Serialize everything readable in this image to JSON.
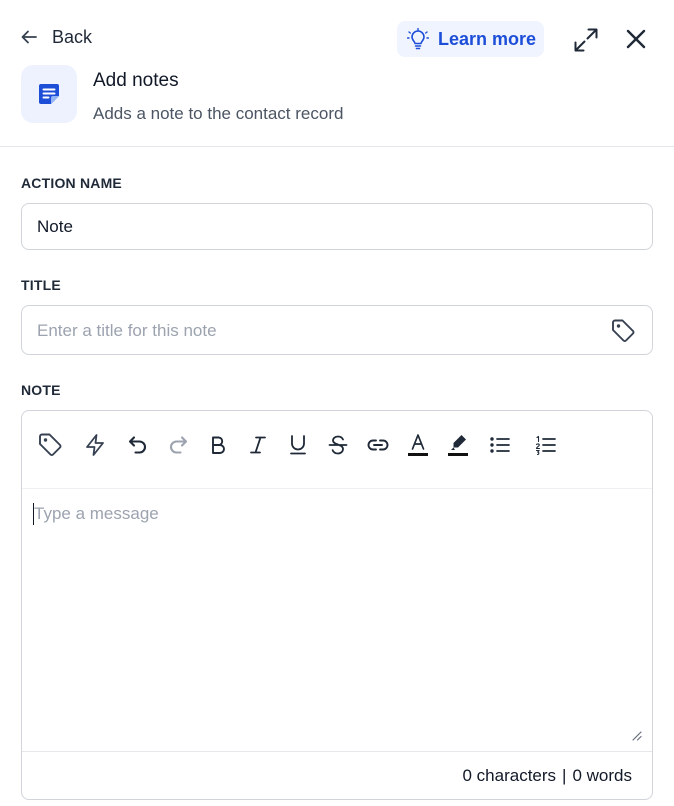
{
  "header": {
    "back_label": "Back",
    "learn_more_label": "Learn more",
    "action_title": "Add notes",
    "action_subtitle": "Adds a note to the contact record"
  },
  "form": {
    "action_name": {
      "label": "ACTION NAME",
      "value": "Note"
    },
    "title": {
      "label": "TITLE",
      "placeholder": "Enter a title for this note",
      "value": ""
    },
    "note": {
      "label": "NOTE",
      "placeholder": "Type a message",
      "value": ""
    }
  },
  "toolbar": {
    "items": [
      "tag-icon",
      "lightning-icon",
      "undo-icon",
      "redo-icon",
      "bold-icon",
      "italic-icon",
      "underline-icon",
      "strikethrough-icon",
      "link-icon",
      "text-color-icon",
      "highlight-icon",
      "bullet-list-icon",
      "numbered-list-icon"
    ]
  },
  "footer": {
    "characters": "0 characters",
    "separator": "|",
    "words": "0 words"
  },
  "colors": {
    "accent": "#1d4ed8",
    "accent_bg": "#eff4ff",
    "border": "#d1d5db",
    "placeholder": "#9ca3af"
  }
}
